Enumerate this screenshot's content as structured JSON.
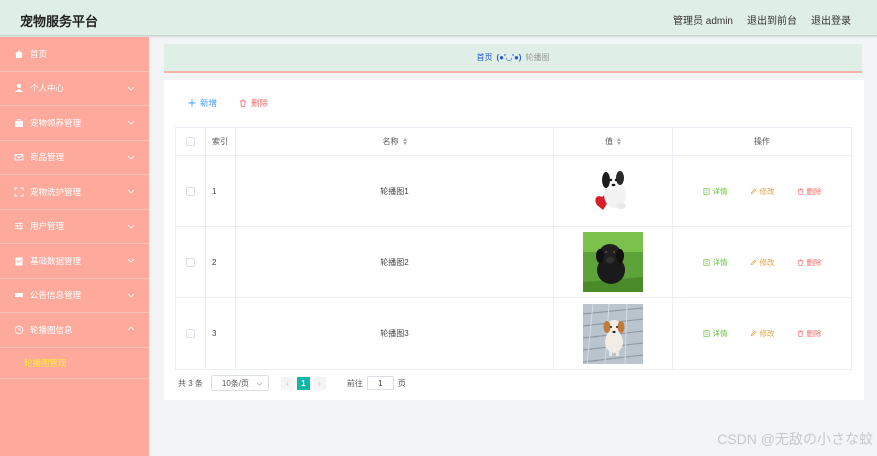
{
  "header": {
    "title": "宠物服务平台",
    "user_label": "管理员 admin",
    "back_to_front": "退出到前台",
    "logout": "退出登录"
  },
  "sidebar": {
    "items": [
      {
        "label": "首页",
        "icon": "home-icon"
      },
      {
        "label": "个人中心",
        "icon": "user-icon"
      },
      {
        "label": "宠物领养管理",
        "icon": "briefcase-icon"
      },
      {
        "label": "商品管理",
        "icon": "mail-icon"
      },
      {
        "label": "宠物洗护管理",
        "icon": "fullscreen-icon"
      },
      {
        "label": "用户管理",
        "icon": "sliders-icon"
      },
      {
        "label": "基础数据管理",
        "icon": "clipboard-icon"
      },
      {
        "label": "公告信息管理",
        "icon": "ticket-icon"
      },
      {
        "label": "轮播图信息",
        "icon": "clock-icon"
      }
    ],
    "active_sub": "轮播图管理"
  },
  "breadcrumb": {
    "home": "首页",
    "face": "(●'◡'●)",
    "current": "轮播图"
  },
  "toolbar": {
    "add_label": "新增",
    "delete_label": "删除"
  },
  "table": {
    "columns": {
      "index": "索引",
      "name": "名称",
      "value": "值",
      "operation": "操作"
    },
    "rows": [
      {
        "index": "1",
        "name": "轮播图1",
        "image": "puppy-with-red-heart"
      },
      {
        "index": "2",
        "name": "轮播图2",
        "image": "black-puppy-on-grass"
      },
      {
        "index": "3",
        "name": "轮播图3",
        "image": "puppy-on-wooden-deck"
      }
    ],
    "ops": {
      "detail": "详情",
      "edit": "修改",
      "remove": "删除"
    }
  },
  "pagination": {
    "total": "共 3 条",
    "page_size": "10条/页",
    "current_page": "1",
    "goto_prefix": "前往",
    "goto_value": "1",
    "goto_suffix": "页"
  },
  "watermark": "CSDN @无敌の小さな蚊",
  "colors": {
    "sidebar": "#fdaa9d",
    "header": "#dfeee6",
    "accent": "#13b5a8",
    "active_sub": "#ffea3a"
  }
}
